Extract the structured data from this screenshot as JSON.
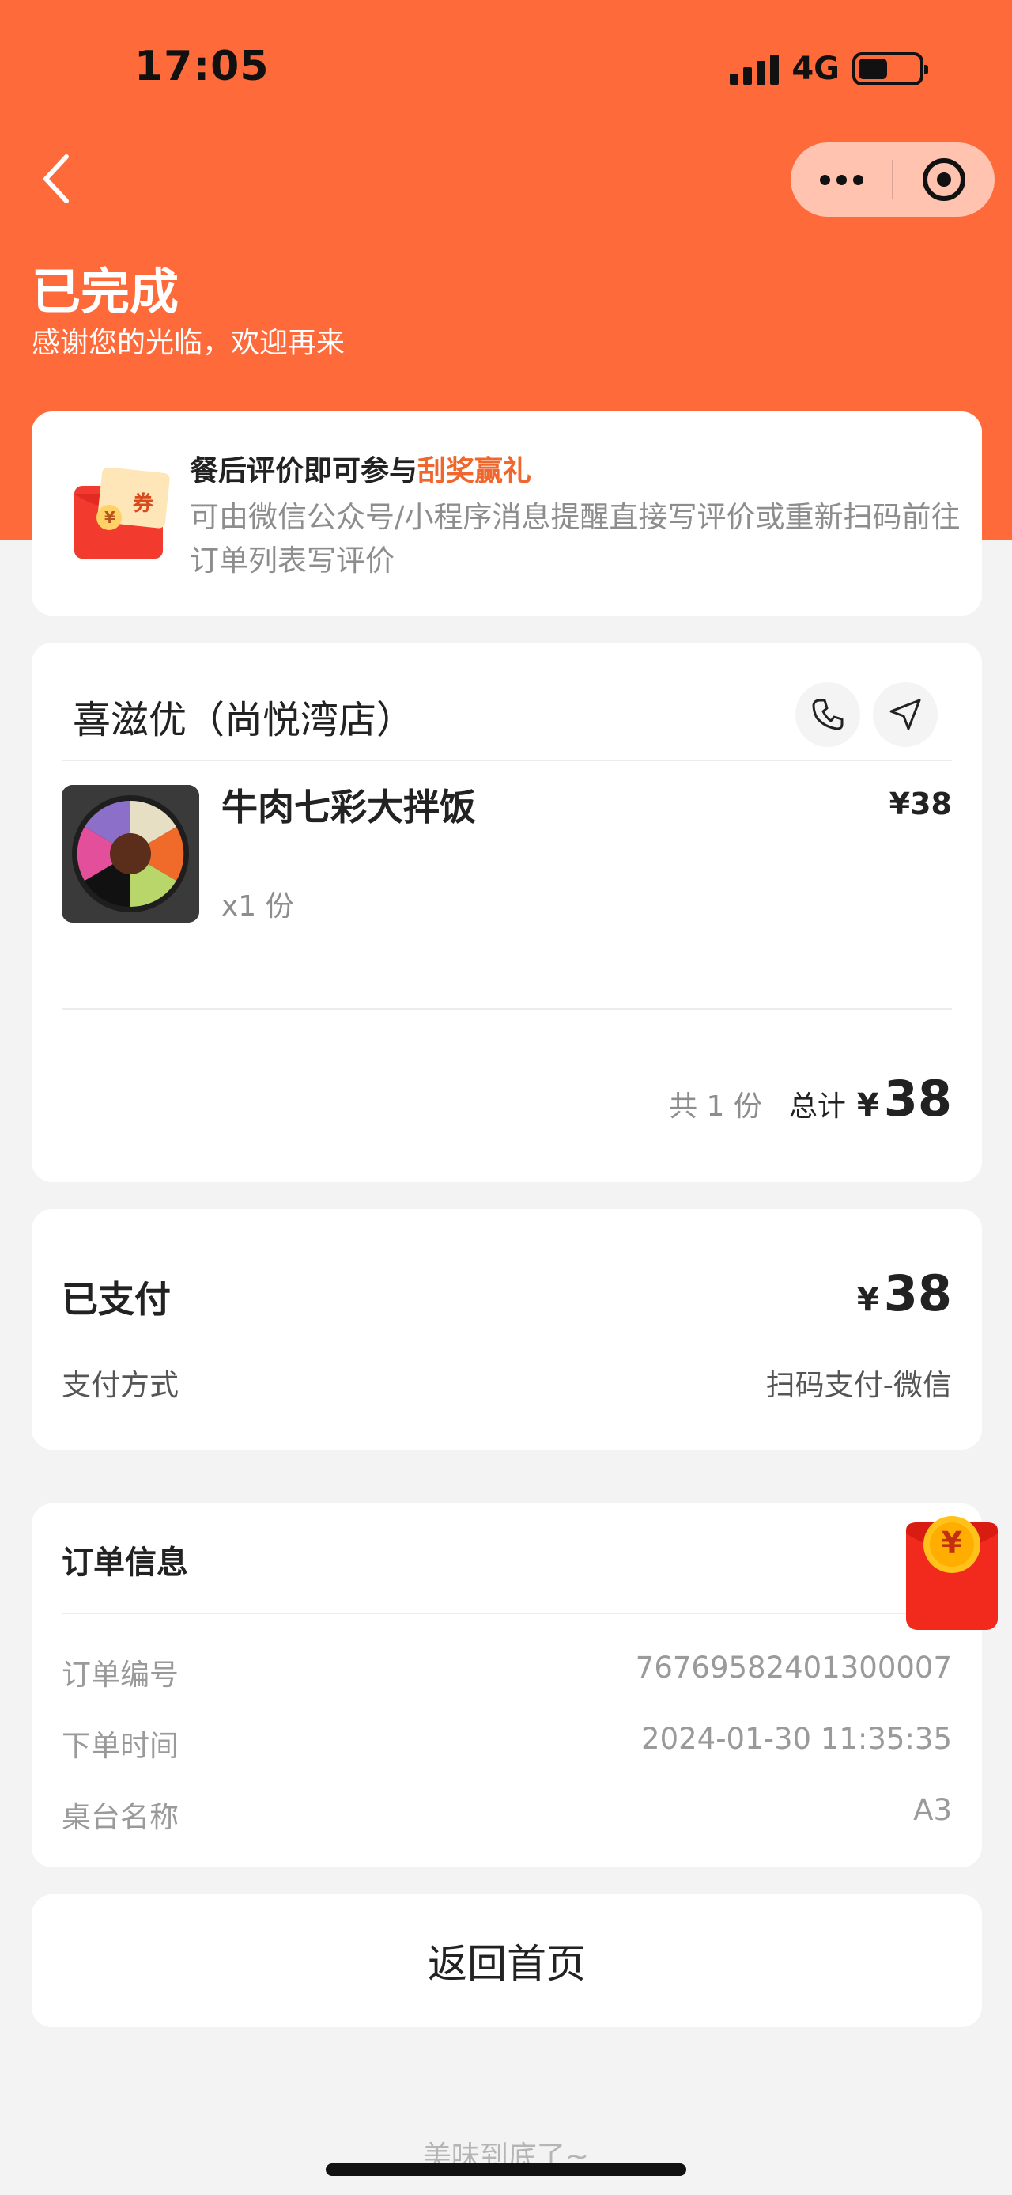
{
  "status_bar": {
    "time": "17:05",
    "network": "4G"
  },
  "header": {
    "status_title": "已完成",
    "status_subtitle": "感谢您的光临，欢迎再来"
  },
  "promo": {
    "title_prefix": "餐后评价即可参与",
    "title_highlight": "刮奖赢礼",
    "description": "可由微信公众号/小程序消息提醒直接写评价或重新扫码前往订单列表写评价",
    "coupon_text": "券",
    "coupon_currency": "¥"
  },
  "shop": {
    "name": "喜滋优（尚悦湾店）",
    "item": {
      "name": "牛肉七彩大拌饭",
      "price": "¥38",
      "quantity": "x1 份"
    },
    "summary": {
      "count": "共 1 份",
      "total_label": "总计",
      "currency": "¥",
      "total": "38"
    }
  },
  "payment": {
    "status_label": "已支付",
    "currency": "¥",
    "amount": "38",
    "method_label": "支付方式",
    "method_value": "扫码支付-微信"
  },
  "order_info": {
    "title": "订单信息",
    "rows": [
      {
        "label": "订单编号",
        "value": "76769582401300007"
      },
      {
        "label": "下单时间",
        "value": "2024-01-30 11:35:35"
      },
      {
        "label": "桌台名称",
        "value": "A3"
      }
    ]
  },
  "red_packet_symbol": "¥",
  "home_button": "返回首页",
  "footer": "美味到底了~",
  "colors": {
    "brand": "#ff6a3a",
    "highlight": "#f0672e"
  }
}
